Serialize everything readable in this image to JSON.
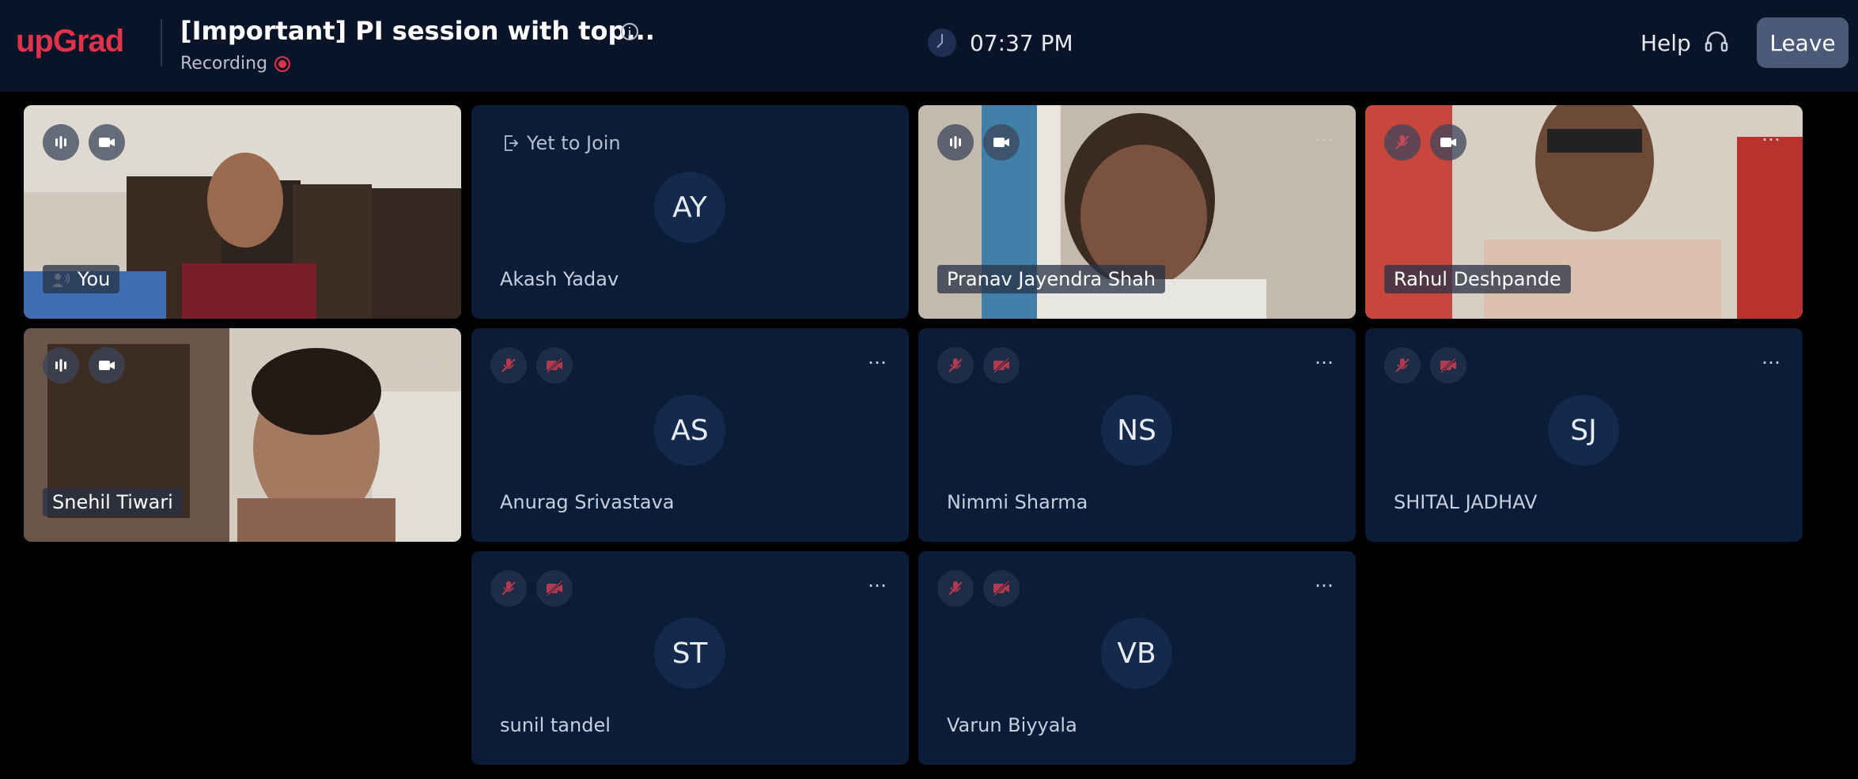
{
  "header": {
    "logo_text": "upGrad",
    "title": "[Important] PI session with top...",
    "recording_label": "Recording",
    "time": "07:37 PM",
    "help_label": "Help",
    "leave_label": "Leave"
  },
  "colors": {
    "brand": "#e0334a",
    "topbar_bg": "#0a1428",
    "tile_bg": "#0b1c38",
    "muted_icon": "#b13a4e"
  },
  "participants": [
    {
      "name": "You",
      "type": "video"
    },
    {
      "name": "Akash Yadav",
      "initials": "AY",
      "status": "Yet to Join"
    },
    {
      "name": "Pranav Jayendra Shah",
      "type": "video"
    },
    {
      "name": "Rahul Deshpande",
      "type": "video"
    },
    {
      "name": "Snehil Tiwari",
      "type": "video"
    },
    {
      "name": "Anurag Srivastava",
      "initials": "AS"
    },
    {
      "name": "Nimmi Sharma",
      "initials": "NS"
    },
    {
      "name": "SHITAL JADHAV",
      "initials": "SJ"
    },
    {
      "name": "sunil tandel",
      "initials": "ST"
    },
    {
      "name": "Varun Biyyala",
      "initials": "VB"
    }
  ],
  "more_label": "…"
}
